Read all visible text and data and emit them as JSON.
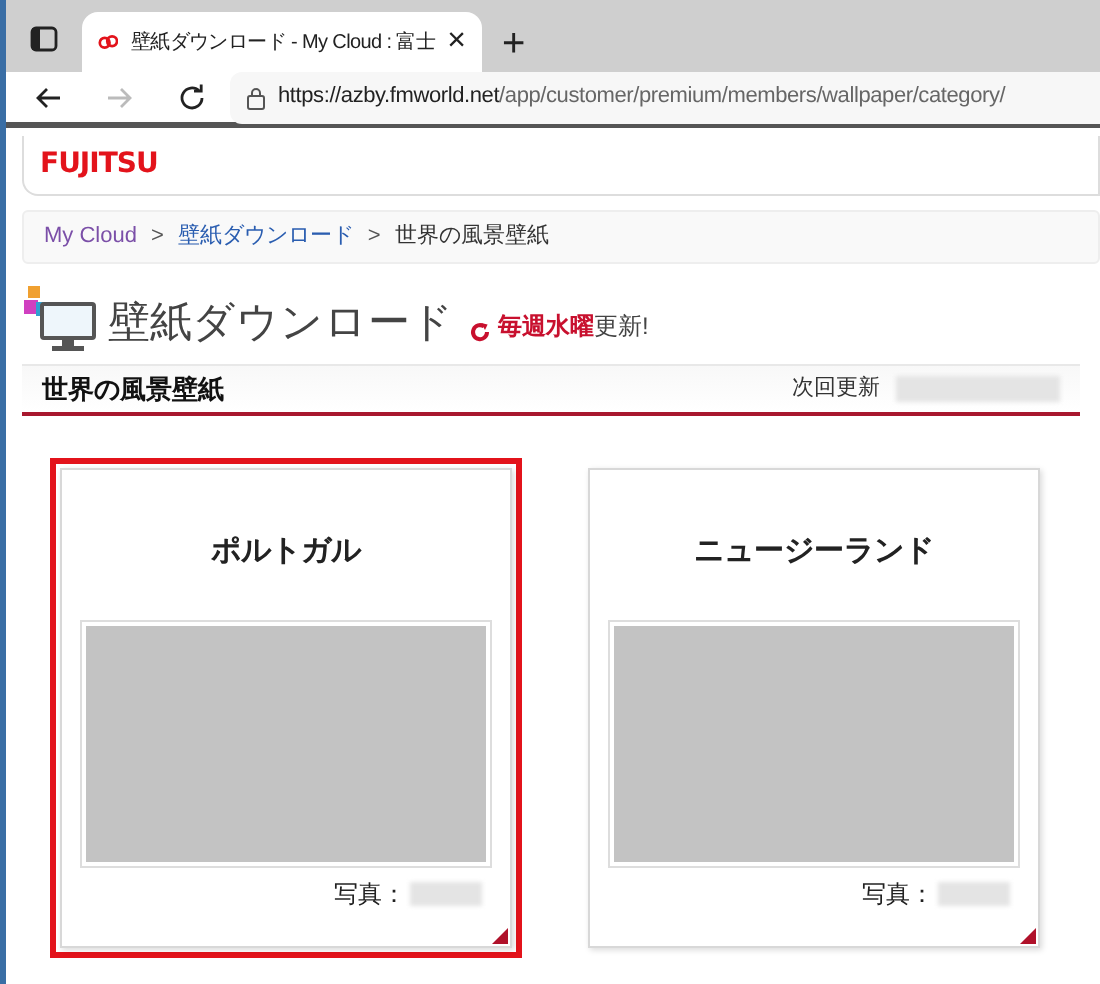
{
  "browser": {
    "tab_title": "壁紙ダウンロード - My Cloud : 富士",
    "new_tab": "+",
    "close": "×",
    "url_host": "https://azby.fmworld.net",
    "url_path": "/app/customer/premium/members/wallpaper/category/"
  },
  "header": {
    "logo": "FUJITSU"
  },
  "breadcrumb": [
    {
      "label": "My Cloud",
      "kind": "visited"
    },
    {
      "label": "壁紙ダウンロード",
      "kind": "link"
    },
    {
      "label": "世界の風景壁紙",
      "kind": "current"
    }
  ],
  "breadcrumb_separator": ">",
  "page_title": "壁紙ダウンロード",
  "update_note": {
    "highlight": "毎週水曜",
    "rest": "更新!"
  },
  "section": {
    "title": "世界の風景壁紙",
    "next_update_label": "次回更新"
  },
  "cards": [
    {
      "title": "ポルトガル",
      "credit_label": "写真：",
      "selected": true
    },
    {
      "title": "ニュージーランド",
      "credit_label": "写真：",
      "selected": false
    }
  ]
}
